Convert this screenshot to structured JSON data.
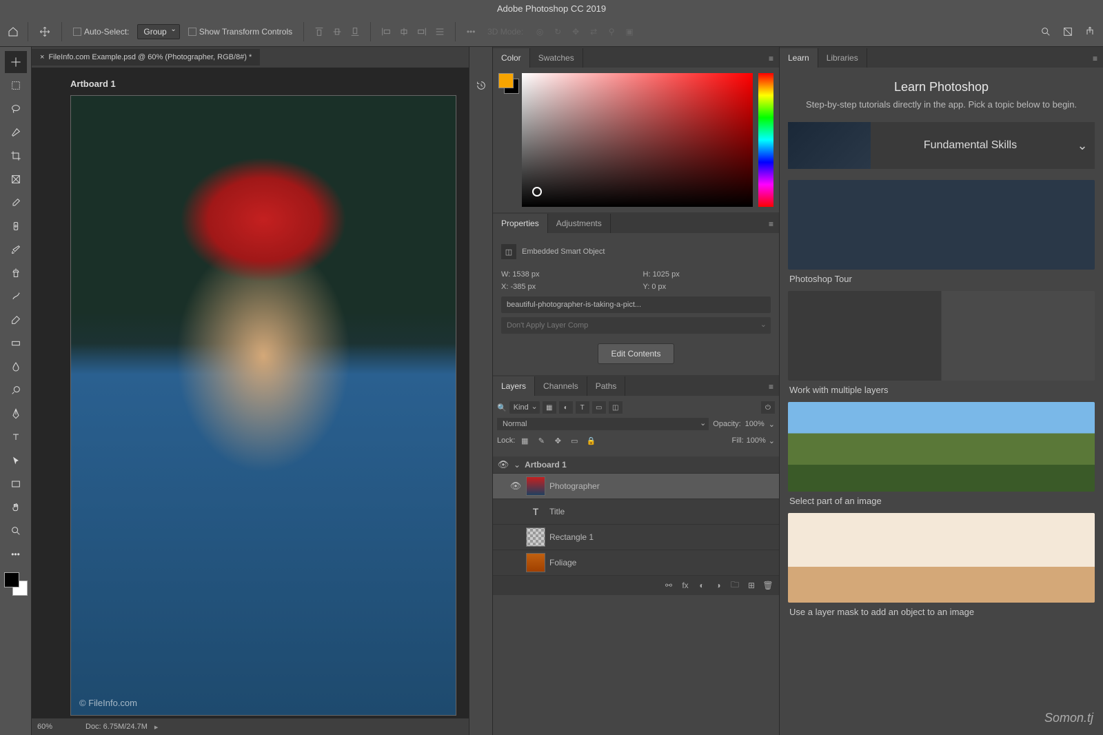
{
  "app_title": "Adobe Photoshop CC 2019",
  "options_bar": {
    "auto_select_label": "Auto-Select:",
    "auto_select_value": "Group",
    "show_transform_label": "Show Transform Controls",
    "mode_label": "3D Mode:"
  },
  "document": {
    "tab_title": "FileInfo.com Example.psd @ 60% (Photographer, RGB/8#) *",
    "artboard_label": "Artboard 1",
    "watermark": "© FileInfo.com"
  },
  "status": {
    "zoom": "60%",
    "doc_size": "Doc: 6.75M/24.7M"
  },
  "color_panel": {
    "tabs": [
      "Color",
      "Swatches"
    ]
  },
  "properties_panel": {
    "tabs": [
      "Properties",
      "Adjustments"
    ],
    "type_label": "Embedded Smart Object",
    "w_label": "W:",
    "w_value": "1538 px",
    "h_label": "H:",
    "h_value": "1025 px",
    "x_label": "X:",
    "x_value": "-385 px",
    "y_label": "Y:",
    "y_value": "0 px",
    "filename": "beautiful-photographer-is-taking-a-pict...",
    "layer_comp": "Don't Apply Layer Comp",
    "edit_button": "Edit Contents"
  },
  "layers_panel": {
    "tabs": [
      "Layers",
      "Channels",
      "Paths"
    ],
    "filter_label": "Kind",
    "blend_mode": "Normal",
    "opacity_label": "Opacity:",
    "opacity_value": "100%",
    "lock_label": "Lock:",
    "fill_label": "Fill:",
    "fill_value": "100%",
    "layers": [
      {
        "name": "Artboard 1",
        "type": "artboard"
      },
      {
        "name": "Photographer",
        "type": "smartobj",
        "selected": true
      },
      {
        "name": "Title",
        "type": "text"
      },
      {
        "name": "Rectangle 1",
        "type": "shape"
      },
      {
        "name": "Foliage",
        "type": "image"
      }
    ]
  },
  "learn_panel": {
    "tabs": [
      "Learn",
      "Libraries"
    ],
    "heading": "Learn Photoshop",
    "sub": "Step-by-step tutorials directly in the app. Pick a topic below to begin.",
    "fundamental": "Fundamental Skills",
    "cards": [
      "Photoshop Tour",
      "Work with multiple layers",
      "Select part of an image",
      "Use a layer mask to add an object to an image"
    ]
  },
  "brand_watermark": "Somon.tj"
}
